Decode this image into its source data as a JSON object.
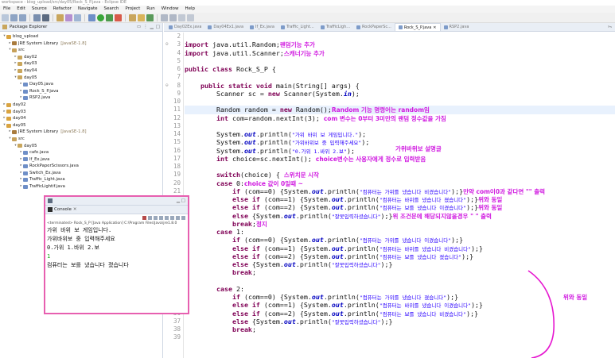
{
  "window": {
    "title": "workspace - blog_upload/src/day05/Rock_S_P.java - Eclipse IDE"
  },
  "menu": [
    "File",
    "Edit",
    "Source",
    "Refactor",
    "Navigate",
    "Search",
    "Project",
    "Run",
    "Window",
    "Help"
  ],
  "package_explorer": {
    "title": "Package Explorer",
    "tree": [
      {
        "indent": 0,
        "twisty": "▾",
        "icon": "project-icon",
        "label": "blog_upload"
      },
      {
        "indent": 1,
        "twisty": "▸",
        "icon": "library-icon",
        "label": "JRE System Library",
        "suffix": "[JavaSE-1.8]"
      },
      {
        "indent": 1,
        "twisty": "▾",
        "icon": "src-folder-icon",
        "label": "src"
      },
      {
        "indent": 2,
        "twisty": "▸",
        "icon": "package-icon",
        "label": "day02"
      },
      {
        "indent": 2,
        "twisty": "▸",
        "icon": "package-icon",
        "label": "day03"
      },
      {
        "indent": 2,
        "twisty": "▸",
        "icon": "package-icon",
        "label": "day04"
      },
      {
        "indent": 2,
        "twisty": "▾",
        "icon": "package-icon",
        "label": "day05"
      },
      {
        "indent": 3,
        "twisty": "▸",
        "icon": "java-file-icon",
        "label": "Day05.java"
      },
      {
        "indent": 3,
        "twisty": "▸",
        "icon": "java-file-icon",
        "label": "Rock_S_P.java"
      },
      {
        "indent": 3,
        "twisty": "▸",
        "icon": "java-file-icon",
        "label": "RSP2.java"
      },
      {
        "indent": 0,
        "twisty": "▸",
        "icon": "project-icon",
        "label": "day02"
      },
      {
        "indent": 0,
        "twisty": "▸",
        "icon": "project-icon",
        "label": "day03"
      },
      {
        "indent": 0,
        "twisty": "▸",
        "icon": "project-icon",
        "label": "day04"
      },
      {
        "indent": 0,
        "twisty": "▾",
        "icon": "project-icon",
        "label": "day05"
      },
      {
        "indent": 1,
        "twisty": "▸",
        "icon": "library-icon",
        "label": "JRE System Library",
        "suffix": "[JavaSE-1.8]"
      },
      {
        "indent": 1,
        "twisty": "▾",
        "icon": "src-folder-icon",
        "label": "src"
      },
      {
        "indent": 2,
        "twisty": "▾",
        "icon": "package-icon",
        "label": "day05"
      },
      {
        "indent": 3,
        "twisty": "▸",
        "icon": "java-file-icon",
        "label": "cafe.java"
      },
      {
        "indent": 3,
        "twisty": "▸",
        "icon": "java-file-icon",
        "label": "If_Ex.java"
      },
      {
        "indent": 3,
        "twisty": "▸",
        "icon": "java-file-icon",
        "label": "RockPaperScissors.java"
      },
      {
        "indent": 3,
        "twisty": "▸",
        "icon": "java-file-icon",
        "label": "Switch_Ex.java"
      },
      {
        "indent": 3,
        "twisty": "▸",
        "icon": "java-file-icon",
        "label": "Traffic_Light.java"
      },
      {
        "indent": 3,
        "twisty": "▸",
        "icon": "java-file-icon",
        "label": "TrafficLightif.java"
      }
    ]
  },
  "editor_tabs": [
    {
      "label": "Day02Ex.java",
      "active": false
    },
    {
      "label": "Day04Ex1.java",
      "active": false
    },
    {
      "label": "If_Ex.java",
      "active": false
    },
    {
      "label": "Traffic_Light...",
      "active": false
    },
    {
      "label": "TrafficLigh...",
      "active": false
    },
    {
      "label": "RockPaperSc...",
      "active": false
    },
    {
      "label": "Rock_S_P.java",
      "active": true
    },
    {
      "label": "RSP2.java",
      "active": false
    }
  ],
  "tab_overflow": "»₅",
  "code_lines": [
    {
      "n": "2",
      "parts": []
    },
    {
      "n": "3",
      "marker": "⊖",
      "parts": [
        [
          "kw",
          "import"
        ],
        [
          "t",
          " java.util.Random;"
        ],
        [
          "a",
          "랜덤기능 추가"
        ]
      ]
    },
    {
      "n": "4",
      "parts": [
        [
          "kw",
          "import"
        ],
        [
          "t",
          " java.util.Scanner;"
        ],
        [
          "a",
          "스캐너기능 추가"
        ]
      ]
    },
    {
      "n": "5",
      "parts": []
    },
    {
      "n": "6",
      "parts": [
        [
          "kw",
          "public class"
        ],
        [
          "t",
          " Rock_S_P {"
        ]
      ]
    },
    {
      "n": "7",
      "parts": []
    },
    {
      "n": "8",
      "marker": "⊖",
      "parts": [
        [
          "t",
          "    "
        ],
        [
          "kw",
          "public static void"
        ],
        [
          "t",
          " main(String[] args) {"
        ]
      ]
    },
    {
      "n": "9",
      "parts": [
        [
          "t",
          "        Scanner sc = "
        ],
        [
          "kw",
          "new"
        ],
        [
          "t",
          " Scanner(System."
        ],
        [
          "f",
          "in"
        ],
        [
          "t",
          ");"
        ]
      ]
    },
    {
      "n": "10",
      "parts": []
    },
    {
      "n": "11",
      "hl": true,
      "parts": [
        [
          "t",
          "        Random random = "
        ],
        [
          "kw",
          "new"
        ],
        [
          "t",
          " Random();"
        ],
        [
          "a",
          "Random 기능 명령어는 random임"
        ]
      ]
    },
    {
      "n": "12",
      "parts": [
        [
          "t",
          "        "
        ],
        [
          "kw",
          "int"
        ],
        [
          "t",
          " com=random.nextInt(3); "
        ],
        [
          "a",
          "com 변수는 0부터 3미만의 랜덤 정수값을 가짐"
        ]
      ]
    },
    {
      "n": "13",
      "parts": []
    },
    {
      "n": "14",
      "parts": [
        [
          "t",
          "        System."
        ],
        [
          "f",
          "out"
        ],
        [
          "t",
          ".println("
        ],
        [
          "s",
          "\"가위 바위 보 게임입니다.\""
        ],
        [
          "t",
          ");"
        ]
      ]
    },
    {
      "n": "15",
      "parts": [
        [
          "t",
          "        System."
        ],
        [
          "f",
          "out"
        ],
        [
          "t",
          ".println("
        ],
        [
          "s",
          "\"가위바위보 중 입력해주세요\""
        ],
        [
          "t",
          ");"
        ]
      ]
    },
    {
      "n": "16",
      "parts": [
        [
          "t",
          "        System."
        ],
        [
          "f",
          "out"
        ],
        [
          "t",
          ".println("
        ],
        [
          "s",
          "\"0.가위 1.바위 2.보\""
        ],
        [
          "t",
          ");"
        ]
      ]
    },
    {
      "n": "17",
      "parts": [
        [
          "t",
          "        "
        ],
        [
          "kw",
          "int"
        ],
        [
          "t",
          " choice=sc.nextInt(); "
        ],
        [
          "a",
          "choice변수는 사용자에게 정수로 입력받음"
        ]
      ]
    },
    {
      "n": "18",
      "parts": []
    },
    {
      "n": "19",
      "parts": [
        [
          "t",
          "        "
        ],
        [
          "kw",
          "switch"
        ],
        [
          "t",
          "(choice) { "
        ],
        [
          "a",
          "스위치문 시작"
        ]
      ]
    },
    {
      "n": "20",
      "parts": [
        [
          "t",
          "        "
        ],
        [
          "kw",
          "case"
        ],
        [
          "t",
          " 0:"
        ],
        [
          "a",
          "choice 값이 0일때 ~"
        ]
      ]
    },
    {
      "n": "21",
      "parts": [
        [
          "t",
          "            "
        ],
        [
          "kw",
          "if"
        ],
        [
          "t",
          " (com==0) {System."
        ],
        [
          "f",
          "out"
        ],
        [
          "t",
          ".println("
        ],
        [
          "s",
          "\"컴퓨터는 가위를 냈습니다 비겼습니다\""
        ],
        [
          "t",
          ");}"
        ],
        [
          "a",
          "만약 com이0과 같다면 \"\" 출력"
        ]
      ]
    },
    {
      "n": "22",
      "parts": [
        [
          "t",
          "            "
        ],
        [
          "kw",
          "else if"
        ],
        [
          "t",
          " (com==1) {System."
        ],
        [
          "f",
          "out"
        ],
        [
          "t",
          ".println("
        ],
        [
          "s",
          "\"컴퓨터는 바위를 냈습니다 졌습니다\""
        ],
        [
          "t",
          ");}"
        ],
        [
          "a",
          "위와 동일"
        ]
      ]
    },
    {
      "n": "23",
      "parts": [
        [
          "t",
          "            "
        ],
        [
          "kw",
          "else if"
        ],
        [
          "t",
          " (com==2) {System."
        ],
        [
          "f",
          "out"
        ],
        [
          "t",
          ".println("
        ],
        [
          "s",
          "\"컴퓨터는 보를 냈습니다 이겼습니다\""
        ],
        [
          "t",
          ");}"
        ],
        [
          "a",
          "위와 동일"
        ]
      ]
    },
    {
      "n": "24",
      "parts": [
        [
          "t",
          "            "
        ],
        [
          "kw",
          "else"
        ],
        [
          "t",
          " {System."
        ],
        [
          "f",
          "out"
        ],
        [
          "t",
          ".println("
        ],
        [
          "s",
          "\"잘못입력하셨습니다\""
        ],
        [
          "t",
          ");}"
        ],
        [
          "a",
          "위 조건문에 해당되지않을경우 \" \" 출력"
        ]
      ]
    },
    {
      "n": "25",
      "parts": [
        [
          "t",
          "            "
        ],
        [
          "kw",
          "break"
        ],
        [
          "t",
          ";"
        ],
        [
          "a",
          "정지"
        ]
      ]
    },
    {
      "n": "26",
      "parts": [
        [
          "t",
          "        "
        ],
        [
          "kw",
          "case"
        ],
        [
          "t",
          " 1:"
        ]
      ]
    },
    {
      "n": "27",
      "parts": [
        [
          "t",
          "            "
        ],
        [
          "kw",
          "if"
        ],
        [
          "t",
          " (com==0) {System."
        ],
        [
          "f",
          "out"
        ],
        [
          "t",
          ".println("
        ],
        [
          "s",
          "\"컴퓨터는 가위를 냈습니다 이겼습니다\""
        ],
        [
          "t",
          ");}"
        ]
      ]
    },
    {
      "n": "28",
      "parts": [
        [
          "t",
          "            "
        ],
        [
          "kw",
          "else if"
        ],
        [
          "t",
          " (com==1) {System."
        ],
        [
          "f",
          "out"
        ],
        [
          "t",
          ".println("
        ],
        [
          "s",
          "\"컴퓨터는 바위를 냈습니다 비겼습니다\""
        ],
        [
          "t",
          ");}"
        ]
      ]
    },
    {
      "n": "29",
      "parts": [
        [
          "t",
          "            "
        ],
        [
          "kw",
          "else if"
        ],
        [
          "t",
          " (com==2) {System."
        ],
        [
          "f",
          "out"
        ],
        [
          "t",
          ".println("
        ],
        [
          "s",
          "\"컴퓨터는 보를 냈습니다 졌습니다\""
        ],
        [
          "t",
          ");}"
        ]
      ]
    },
    {
      "n": "30",
      "parts": [
        [
          "t",
          "            "
        ],
        [
          "kw",
          "else"
        ],
        [
          "t",
          " {System."
        ],
        [
          "f",
          "out"
        ],
        [
          "t",
          ".println("
        ],
        [
          "s",
          "\"잘못입력하셨습니다\""
        ],
        [
          "t",
          ");}"
        ]
      ]
    },
    {
      "n": "31",
      "parts": [
        [
          "t",
          "            "
        ],
        [
          "kw",
          "break"
        ],
        [
          "t",
          ";"
        ]
      ]
    },
    {
      "n": "32",
      "parts": []
    },
    {
      "n": "33",
      "parts": [
        [
          "t",
          "        "
        ],
        [
          "kw",
          "case"
        ],
        [
          "t",
          " 2:"
        ]
      ]
    },
    {
      "n": "34",
      "parts": [
        [
          "t",
          "            "
        ],
        [
          "kw",
          "if"
        ],
        [
          "t",
          " (com==0) {System."
        ],
        [
          "f",
          "out"
        ],
        [
          "t",
          ".println("
        ],
        [
          "s",
          "\"컴퓨터는 가위를 냈습니다 졌습니다\""
        ],
        [
          "t",
          ");}"
        ]
      ]
    },
    {
      "n": "35",
      "parts": [
        [
          "t",
          "            "
        ],
        [
          "kw",
          "else if"
        ],
        [
          "t",
          " (com==1) {System."
        ],
        [
          "f",
          "out"
        ],
        [
          "t",
          ".println("
        ],
        [
          "s",
          "\"컴퓨터는 바위를 냈습니다 이겼습니다\""
        ],
        [
          "t",
          ");}"
        ]
      ]
    },
    {
      "n": "36",
      "parts": [
        [
          "t",
          "            "
        ],
        [
          "kw",
          "else if"
        ],
        [
          "t",
          " (com==2) {System."
        ],
        [
          "f",
          "out"
        ],
        [
          "t",
          ".println("
        ],
        [
          "s",
          "\"컴퓨터는 보를 냈습니다 비겼습니다\""
        ],
        [
          "t",
          ");}"
        ]
      ]
    },
    {
      "n": "37",
      "parts": [
        [
          "t",
          "            "
        ],
        [
          "kw",
          "else"
        ],
        [
          "t",
          " {System."
        ],
        [
          "f",
          "out"
        ],
        [
          "t",
          ".println("
        ],
        [
          "s",
          "\"잘못입력하셨습니다\""
        ],
        [
          "t",
          ");}"
        ]
      ]
    },
    {
      "n": "38",
      "parts": [
        [
          "t",
          "            "
        ],
        [
          "kw",
          "break"
        ],
        [
          "t",
          ";"
        ]
      ]
    },
    {
      "n": "39",
      "parts": []
    }
  ],
  "notes": {
    "rps_explain": "가위바위보 설명글",
    "same_as_above": "위와 동일"
  },
  "console": {
    "title": "Console",
    "terminated": "<terminated> Rock_S_P [Java Application] C:\\Program Files\\Java\\jre1.8.0",
    "lines": [
      {
        "text": "가위 바위 보 게임입니다.",
        "input": false
      },
      {
        "text": "가위바위보 중 입력해주세요",
        "input": false
      },
      {
        "text": "0.가위 1.바위 2.보",
        "input": false
      },
      {
        "text": "1",
        "input": true
      },
      {
        "text": "컴퓨터는 보를 냈습니다 졌습니다",
        "input": false
      }
    ]
  },
  "colors": {
    "annotation": "#d01ae0",
    "console_border": "#e75fb0",
    "keyword": "#7f0055",
    "string": "#2a00ff"
  }
}
